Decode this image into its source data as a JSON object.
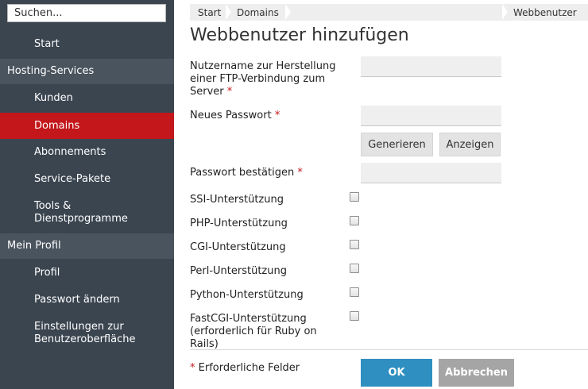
{
  "sidebar": {
    "search_placeholder": "Suchen...",
    "start": "Start",
    "group_hosting": "Hosting-Services",
    "kunden": "Kunden",
    "domains": "Domains",
    "abonnements": "Abonnements",
    "service_pakete": "Service-Pakete",
    "tools": "Tools &\nDienstprogramme",
    "group_profil": "Mein Profil",
    "profil": "Profil",
    "passwort_aendern": "Passwort ändern",
    "einstellungen": "Einstellungen zur\nBenutzeroberfläche"
  },
  "breadcrumb": {
    "start": "Start",
    "domains": "Domains",
    "current": "Webbenutzer"
  },
  "page_title": "Webbenutzer hinzufügen",
  "form": {
    "username_label": "Nutzername zur Herstellung einer FTP-Verbindung zum Server",
    "new_password_label": "Neues Passwort",
    "generate_button": "Generieren",
    "show_button": "Anzeigen",
    "confirm_password_label": "Passwort bestätigen",
    "required_marker": "*",
    "ssi_label": "SSI-Unterstützung",
    "php_label": "PHP-Unterstützung",
    "cgi_label": "CGI-Unterstützung",
    "perl_label": "Perl-Unterstützung",
    "python_label": "Python-Unterstützung",
    "fastcgi_label": "FastCGI-Unterstützung (erforderlich für Ruby on Rails)",
    "required_fields_note": "Erforderliche Felder",
    "ok_button": "OK",
    "cancel_button": "Abbrechen"
  },
  "colors": {
    "sidebar_bg": "#3b4550",
    "sidebar_group_bg": "#4a545e",
    "active_item_bg": "#c3171b",
    "required_marker": "#c3171b",
    "ok_button": "#2f8fc1",
    "cancel_button": "#a5a5a5"
  }
}
